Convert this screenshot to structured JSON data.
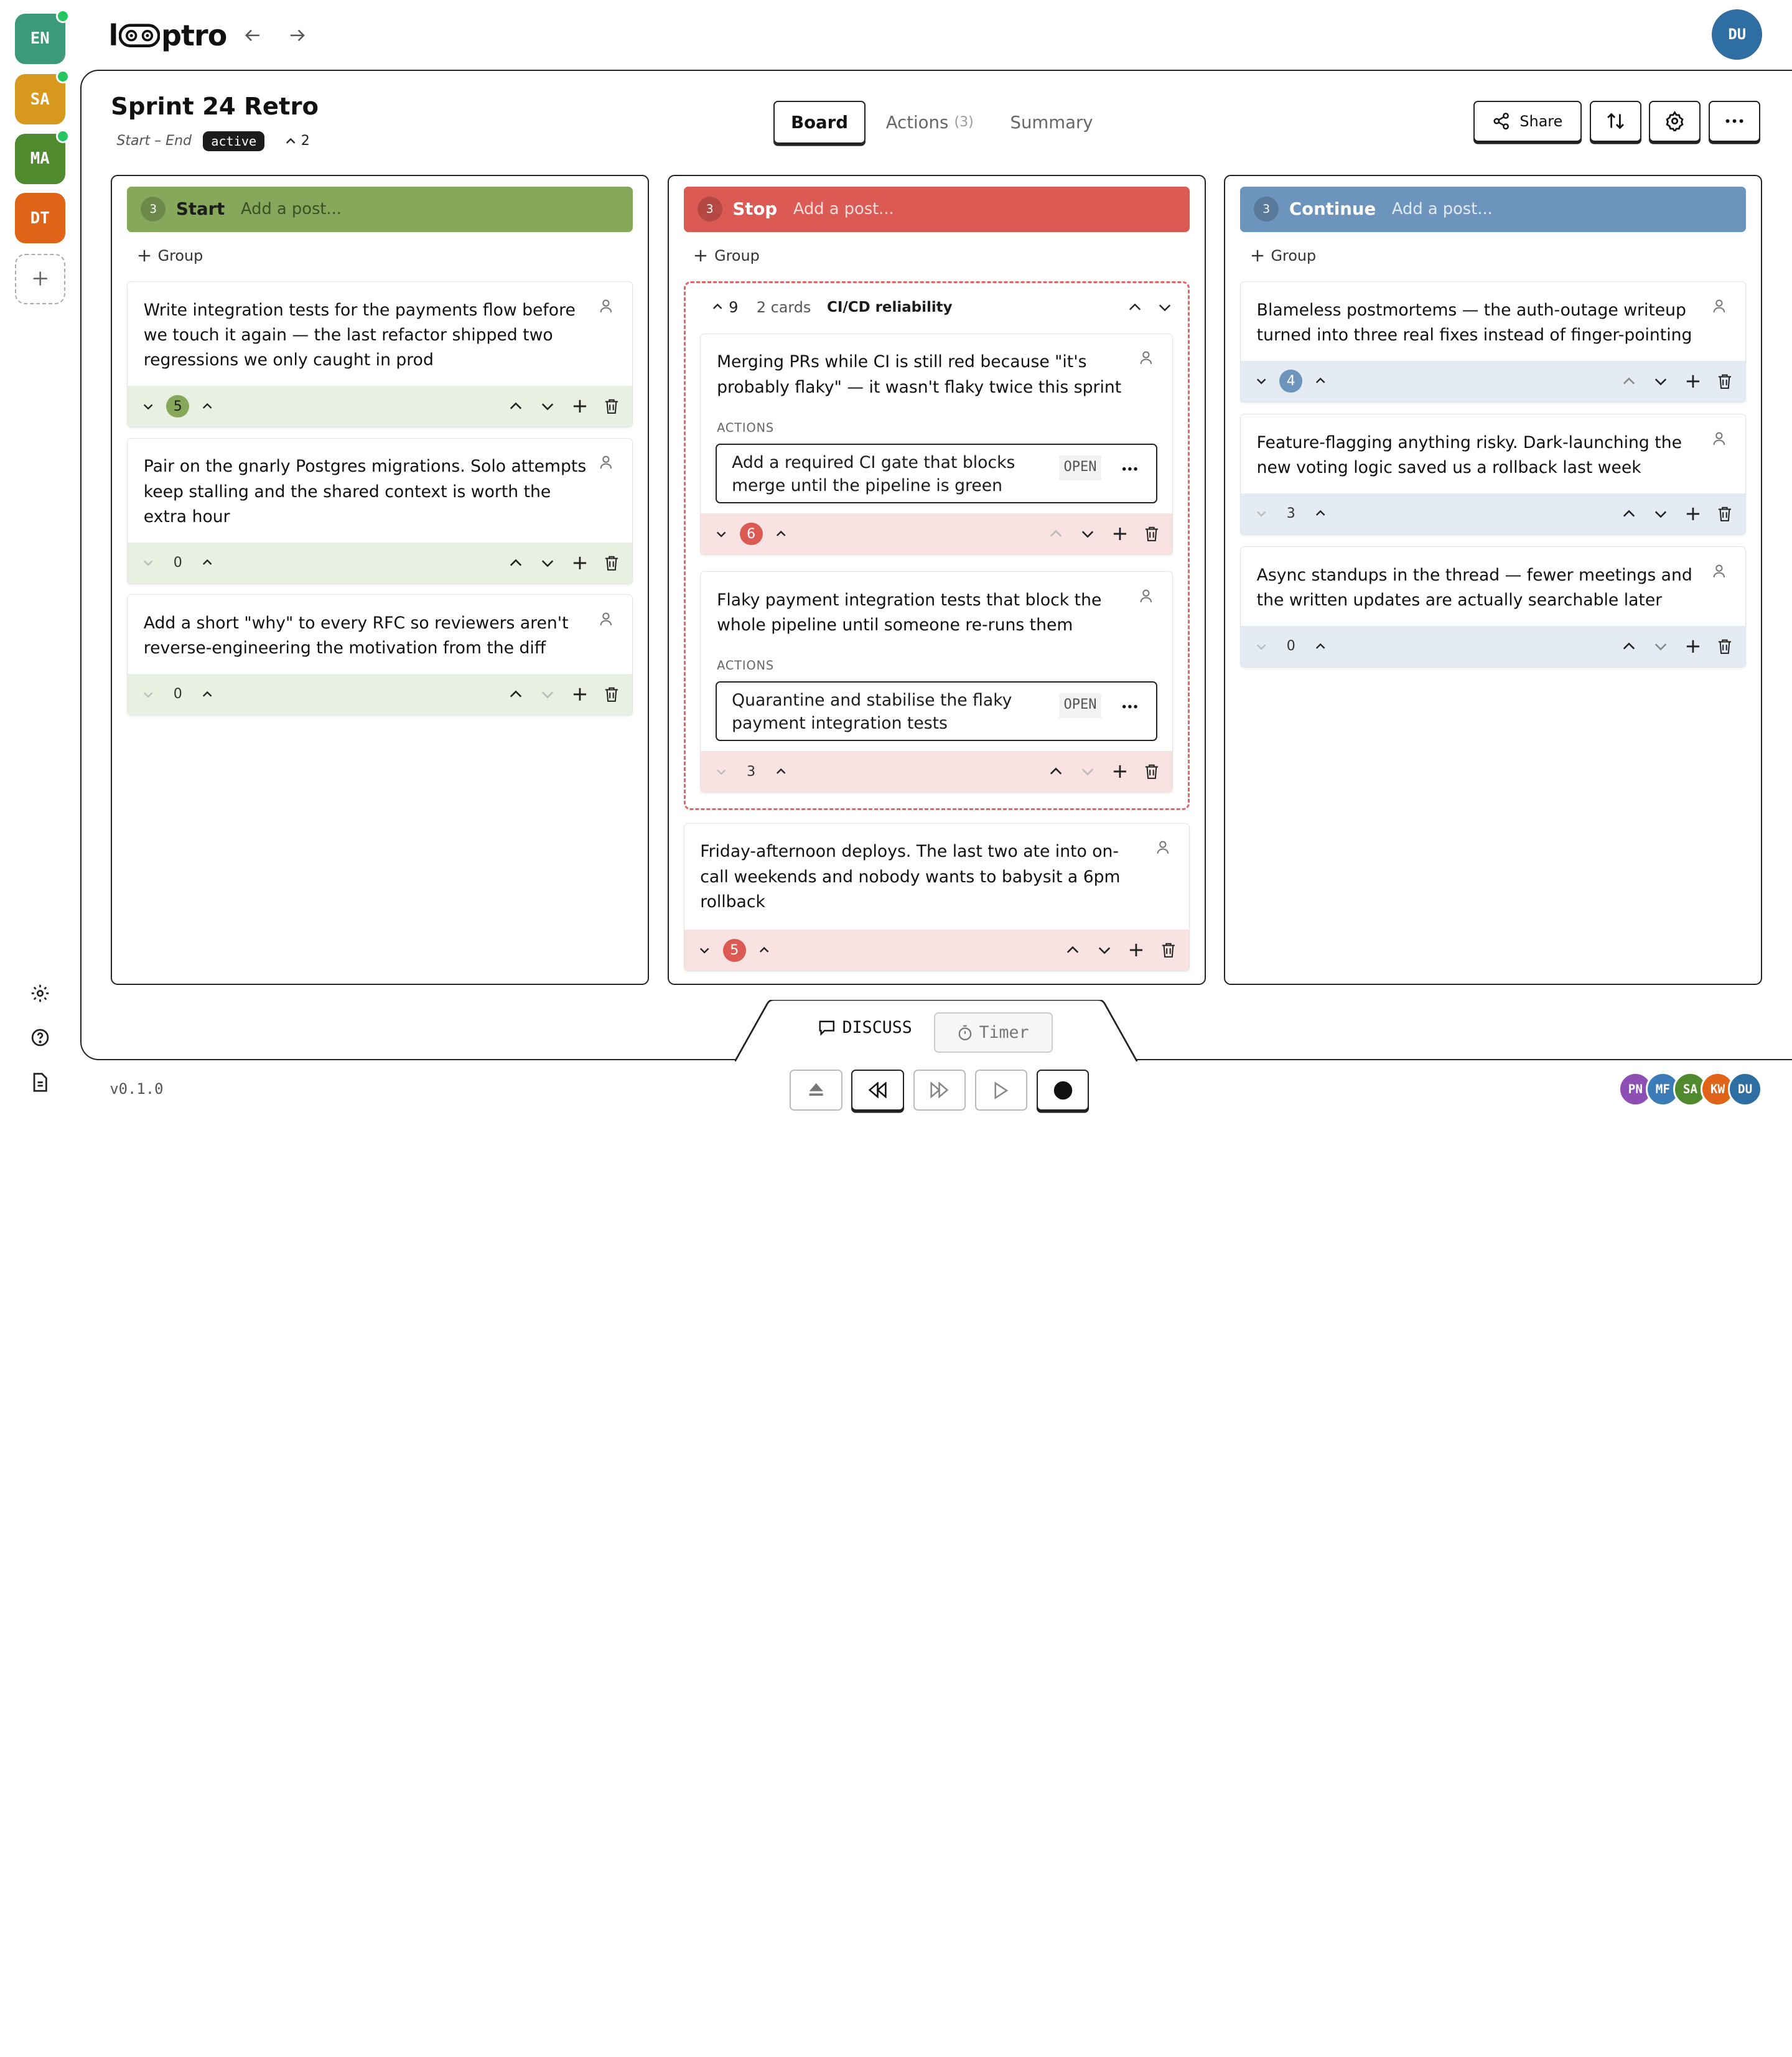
{
  "app": {
    "logo": "loptro",
    "version": "v0.1.0",
    "user_initials": "DU"
  },
  "workspaces": [
    {
      "initials": "EN",
      "color": "#3d9a78",
      "online": true
    },
    {
      "initials": "SA",
      "color": "#d89a1e",
      "online": true
    },
    {
      "initials": "MA",
      "color": "#4f8a2e",
      "online": true
    },
    {
      "initials": "DT",
      "color": "#e06418",
      "online": false
    }
  ],
  "board": {
    "title": "Sprint 24 Retro",
    "range": "Start – End",
    "status": "active",
    "upvotes": "2"
  },
  "tabs": [
    {
      "label": "Board",
      "count": ""
    },
    {
      "label": "Actions",
      "count": "(3)"
    },
    {
      "label": "Summary",
      "count": ""
    }
  ],
  "toolbar": {
    "share": "Share"
  },
  "group_label": "Group",
  "columns": [
    {
      "name": "Start",
      "count": "3",
      "placeholder": "Add a post...",
      "color": "#86a85a",
      "tint": "#eaf0e1",
      "badge": "#86a85a",
      "cards": [
        {
          "text": "Write integration tests for the payments flow before we touch it again — the last refactor shipped two regressions we only caught in prod",
          "votes": "5"
        },
        {
          "text": "Pair on the gnarly Postgres migrations. Solo attempts keep stalling and the shared context is worth the extra hour",
          "votes": "0"
        },
        {
          "text": "Add a short \"why\" to every RFC so reviewers aren't reverse-engineering the motivation from the diff",
          "votes": "0"
        }
      ]
    },
    {
      "name": "Stop",
      "count": "3",
      "placeholder": "Add a post...",
      "color": "#dc5a54",
      "tint": "#f9e2e2",
      "badge": "#dc5a54",
      "group": {
        "votes": "9",
        "cards_count": "2 cards",
        "name": "CI/CD reliability"
      },
      "cards": [
        {
          "text": "Merging PRs while CI is still red because \"it's probably flaky\" — it wasn't flaky twice this sprint",
          "votes": "6",
          "actions_label": "ACTIONS",
          "action": "Add a required CI gate that blocks merge until the pipeline is green",
          "action_status": "OPEN"
        },
        {
          "text": "Flaky payment integration tests that block the whole pipeline until someone re-runs them",
          "votes": "3",
          "actions_label": "ACTIONS",
          "action": "Quarantine and stabilise the flaky payment integration tests",
          "action_status": "OPEN"
        },
        {
          "text": "Friday-afternoon deploys. The last two ate into on-call weekends and nobody wants to babysit a 6pm rollback",
          "votes": "5"
        }
      ]
    },
    {
      "name": "Continue",
      "count": "3",
      "placeholder": "Add a post...",
      "color": "#6d94bd",
      "tint": "#e5ebf2",
      "badge": "#6d94bd",
      "cards": [
        {
          "text": "Blameless postmortems — the auth-outage writeup turned into three real fixes instead of finger-pointing",
          "votes": "4"
        },
        {
          "text": "Feature-flagging anything risky. Dark-launching the new voting logic saved us a rollback last week",
          "votes": "3"
        },
        {
          "text": "Async standups in the thread — fewer meetings and the written updates are actually searchable later",
          "votes": "0"
        }
      ]
    }
  ],
  "bottom": {
    "discuss": "DISCUSS",
    "timer": "Timer"
  },
  "participants": [
    {
      "initials": "PN",
      "color": "#8e4fb5"
    },
    {
      "initials": "MF",
      "color": "#3a7bb8"
    },
    {
      "initials": "SA",
      "color": "#4f8a2e"
    },
    {
      "initials": "KW",
      "color": "#e06418"
    },
    {
      "initials": "DU",
      "color": "#2f6ea3"
    }
  ]
}
